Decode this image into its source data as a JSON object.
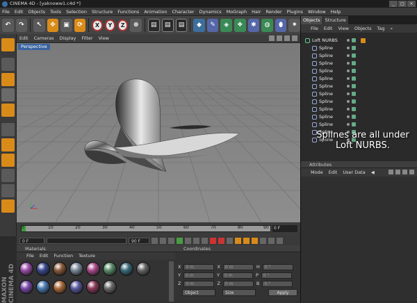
{
  "window": {
    "title": "CINEMA 4D - [yaknoww1.c4d *]"
  },
  "menubar": [
    "File",
    "Edit",
    "Objects",
    "Tools",
    "Selection",
    "Structure",
    "Functions",
    "Animation",
    "Character",
    "Dynamics",
    "MoGraph",
    "Hair",
    "Render",
    "Plugins",
    "Window",
    "Help"
  ],
  "toolbar": {
    "axes": [
      "X",
      "Y",
      "Z"
    ]
  },
  "viewport": {
    "menu": [
      "Edit",
      "Cameras",
      "Display",
      "Filter",
      "View"
    ],
    "label": "Perspective"
  },
  "timeline": {
    "ticks": [
      "0",
      "10",
      "20",
      "30",
      "40",
      "50",
      "60",
      "70",
      "80",
      "90"
    ],
    "current_frame": "0 F",
    "end_frame": "90 F"
  },
  "transport": {
    "start": "0 F",
    "end": "90 F"
  },
  "materials": {
    "title": "Materials",
    "menu": [
      "File",
      "Edit",
      "Function",
      "Texture"
    ],
    "ball_colors": [
      "#9a4fa8",
      "#3b4a8c",
      "#8a5a3a",
      "#7a8a9a",
      "#a84a8a",
      "#5a8a6a",
      "#3a6a7a",
      "#666666",
      "#7a4aa8",
      "#4a7ab0",
      "#a86a3a",
      "#5a5aa0",
      "#8a3a5a",
      "#6a6a6a"
    ]
  },
  "coordinates": {
    "title": "Coordinates",
    "rows": [
      {
        "a": "X",
        "av": "0 m",
        "b": "X",
        "bv": "0 m",
        "c": "H",
        "cv": "0 °"
      },
      {
        "a": "Y",
        "av": "0 m",
        "b": "Y",
        "bv": "0 m",
        "c": "P",
        "cv": "0 °"
      },
      {
        "a": "Z",
        "av": "0 m",
        "b": "Z",
        "bv": "0 m",
        "c": "B",
        "cv": "0 °"
      }
    ],
    "mode": "Object",
    "size": "Size",
    "apply": "Apply"
  },
  "objects": {
    "tabs": [
      "Objects",
      "Structure"
    ],
    "menu": [
      "File",
      "Edit",
      "View",
      "Objects",
      "Tag"
    ],
    "root": "Loft NURBS",
    "children": [
      "Spline",
      "Spline",
      "Spline",
      "Spline",
      "Spline",
      "Spline",
      "Spline",
      "Spline",
      "Spline",
      "Spline",
      "Spline",
      "Spline",
      "Spline"
    ]
  },
  "annotation": {
    "line1": "Splines are all under",
    "line2": "Loft NURBS."
  },
  "attributes": {
    "title": "Attributes",
    "menu": [
      "Mode",
      "Edit",
      "User Data"
    ]
  },
  "brand": {
    "maxon": "MAXON CINEMA 4D"
  }
}
